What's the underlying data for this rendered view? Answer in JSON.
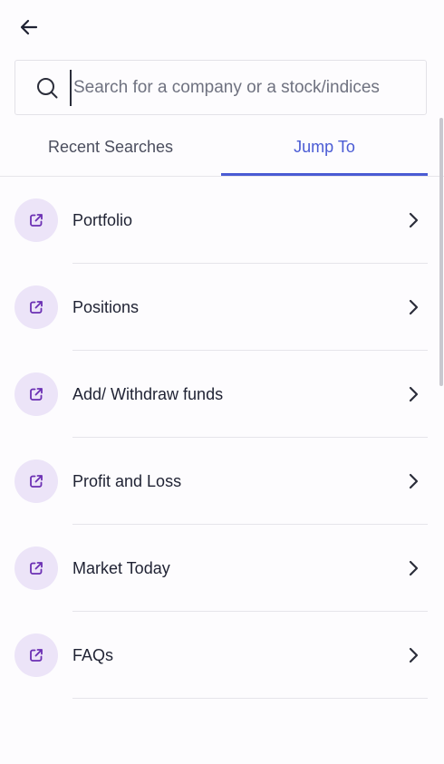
{
  "header": {
    "back_icon": "arrow-left-icon"
  },
  "search": {
    "icon": "search-icon",
    "placeholder": "Search for a company or a stock/indices",
    "value": ""
  },
  "tabs": [
    {
      "label": "Recent Searches",
      "active": false
    },
    {
      "label": "Jump To",
      "active": true
    }
  ],
  "colors": {
    "accent": "#4a5bd4",
    "icon_bg": "#ece4f8",
    "icon_fg": "#6b2fb3"
  },
  "jump_to": {
    "items": [
      {
        "label": "Portfolio",
        "icon": "external-link-icon"
      },
      {
        "label": "Positions",
        "icon": "external-link-icon"
      },
      {
        "label": "Add/ Withdraw funds",
        "icon": "external-link-icon"
      },
      {
        "label": "Profit and Loss",
        "icon": "external-link-icon"
      },
      {
        "label": "Market Today",
        "icon": "external-link-icon"
      },
      {
        "label": "FAQs",
        "icon": "external-link-icon"
      }
    ]
  }
}
